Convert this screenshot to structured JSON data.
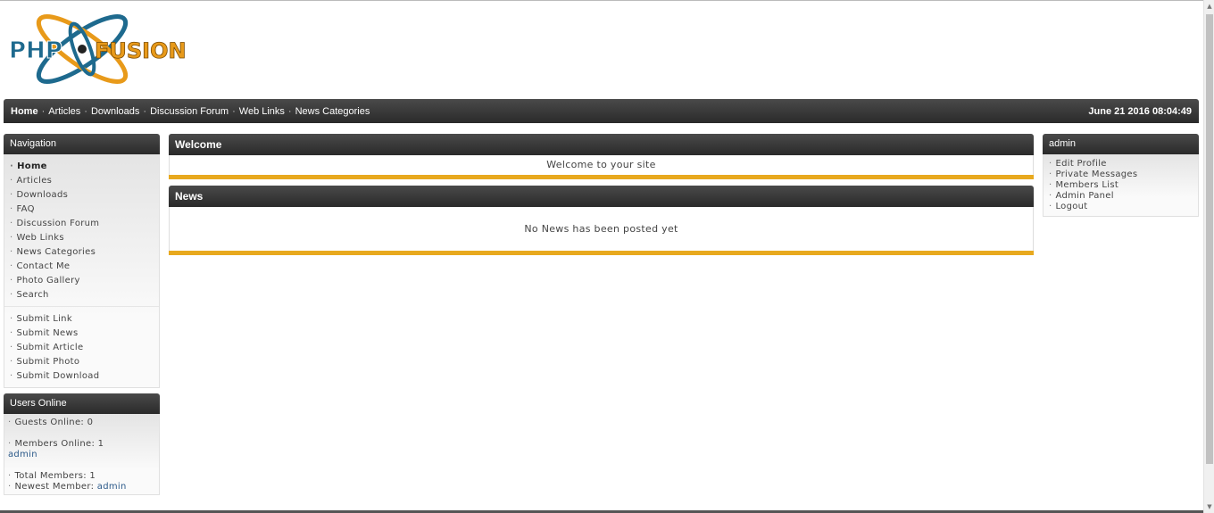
{
  "logo": {
    "text_left": "PHP",
    "text_right": "FUSION",
    "colors": {
      "blue": "#1e6a8e",
      "orange": "#e89a1a"
    }
  },
  "menubar": {
    "links": [
      "Home",
      "Articles",
      "Downloads",
      "Discussion Forum",
      "Web Links",
      "News Categories"
    ],
    "current": "Home",
    "separator": "·",
    "datetime": "June 21 2016 08:04:49"
  },
  "navigation": {
    "title": "Navigation",
    "bullet": "·",
    "items": [
      "Home",
      "Articles",
      "Downloads",
      "FAQ",
      "Discussion Forum",
      "Web Links",
      "News Categories",
      "Contact Me",
      "Photo Gallery",
      "Search"
    ],
    "submit_items": [
      "Submit Link",
      "Submit News",
      "Submit Article",
      "Submit Photo",
      "Submit Download"
    ]
  },
  "users_online": {
    "title": "Users Online",
    "guests_label": "Guests Online:",
    "guests_count": "0",
    "members_label": "Members Online:",
    "members_count": "1",
    "members_list": "admin",
    "total_label": "Total Members:",
    "total_count": "1",
    "newest_label": "Newest Member:",
    "newest_name": "admin"
  },
  "welcome": {
    "title": "Welcome",
    "message": "Welcome to your site"
  },
  "news": {
    "title": "News",
    "message": "No News has been posted yet"
  },
  "user_panel": {
    "title": "admin",
    "items": [
      "Edit Profile",
      "Private Messages",
      "Members List",
      "Admin Panel",
      "Logout"
    ]
  },
  "colors": {
    "header_bar": "#333333",
    "accent_stripe": "#e8a91e",
    "link": "#2c5a8a"
  }
}
